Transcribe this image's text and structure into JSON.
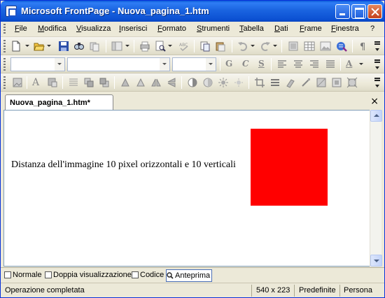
{
  "window": {
    "title": "Microsoft FrontPage - Nuova_pagina_1.htm"
  },
  "menu": {
    "items": [
      "File",
      "Modifica",
      "Visualizza",
      "Inserisci",
      "Formato",
      "Strumenti",
      "Tabella",
      "Dati",
      "Frame",
      "Finestra",
      "?"
    ]
  },
  "toolbar_standard": {
    "icons": [
      "new-page-icon",
      "open-icon",
      "save-icon",
      "search-icon",
      "publish-icon",
      "folder-list-icon",
      "print-icon",
      "print-preview-icon",
      "spelling-icon",
      "cut-icon",
      "copy-icon",
      "undo-icon",
      "redo-icon",
      "web-component-icon",
      "insert-table-icon",
      "insert-picture-icon",
      "hyperlink-icon",
      "show-all-icon"
    ]
  },
  "toolbar_formatting": {
    "style_value": "",
    "font_value": "",
    "size_value": "",
    "bold_glyph": "G",
    "italic_glyph": "C",
    "underline_glyph": "S",
    "font_color_glyph": "A"
  },
  "document": {
    "tab_label": "Nuova_pagina_1.htm*",
    "close_glyph": "×",
    "body_text": "Distanza dell'immagine 10 pixel orizzontali e 10 verticali",
    "image_color": "#ff0000"
  },
  "view_tabs": [
    {
      "label": "Normale",
      "icon": "normal-view-icon",
      "active": false
    },
    {
      "label": "Doppia visualizzazione",
      "icon": "split-view-icon",
      "active": false
    },
    {
      "label": "Codice",
      "icon": "code-view-icon",
      "active": false
    },
    {
      "label": "Anteprima",
      "icon": "preview-icon",
      "active": true
    }
  ],
  "status": {
    "message": "Operazione completata",
    "dimensions": "540 x 223",
    "mode": "Predefinite",
    "custom": "Persona"
  },
  "colors": {
    "titlebar": "#0b50d2",
    "chrome": "#ece9d8",
    "accent": "#316ac5"
  }
}
